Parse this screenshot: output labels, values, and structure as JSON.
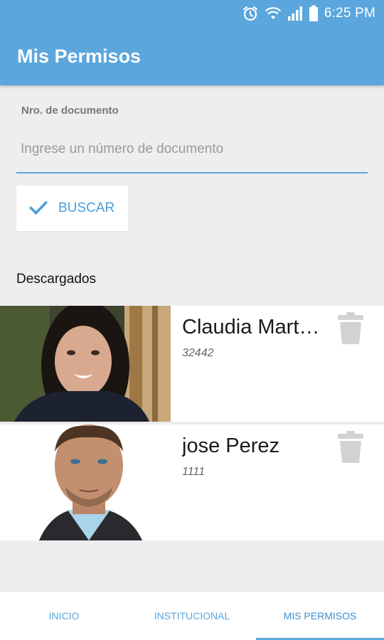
{
  "status_bar": {
    "time": "6:25 PM",
    "icons": [
      "alarm-icon",
      "wifi-icon",
      "signal-icon",
      "battery-icon"
    ]
  },
  "app_bar": {
    "title": "Mis Permisos"
  },
  "form": {
    "label": "Nro. de documento",
    "input_value": "",
    "input_placeholder": "Ingrese un número de documento",
    "search_button_label": "BUSCAR",
    "search_button_icon": "check-icon"
  },
  "downloads": {
    "title": "Descargados",
    "items": [
      {
        "name": "Claudia Martinez",
        "name_display": "Claudia Mart…",
        "document": "32442",
        "delete_icon": "trash-icon"
      },
      {
        "name": "jose Perez",
        "name_display": "jose Perez",
        "document": "1111",
        "delete_icon": "trash-icon"
      }
    ]
  },
  "bottom_nav": {
    "tabs": [
      {
        "label": "INICIO",
        "active": false
      },
      {
        "label": "INSTITUCIONAL",
        "active": false
      },
      {
        "label": "MIS PERMISOS",
        "active": true
      }
    ]
  },
  "colors": {
    "primary": "#5aa6dd",
    "accent_text": "#4a9fd9",
    "background": "#eeeef0"
  }
}
